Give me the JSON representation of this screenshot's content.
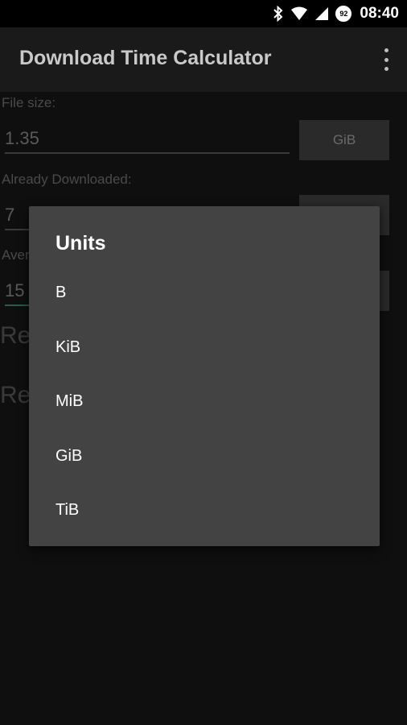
{
  "status_bar": {
    "icons": [
      "bluetooth-icon",
      "wifi-icon",
      "signal-icon"
    ],
    "battery": "92",
    "time": "08:40"
  },
  "app_bar": {
    "title": "Download Time Calculator",
    "menu_icon": "overflow-menu-icon"
  },
  "form": {
    "file_size": {
      "label": "File size:",
      "value": "1.35",
      "unit": "GiB"
    },
    "already_downloaded": {
      "label": "Already Downloaded:",
      "value": "7"
    },
    "average_speed": {
      "label_partial": "Aver",
      "value_partial": "15"
    },
    "result_1": "Re",
    "result_2": "Re"
  },
  "dialog": {
    "title": "Units",
    "options": [
      "B",
      "KiB",
      "MiB",
      "GiB",
      "TiB"
    ]
  }
}
